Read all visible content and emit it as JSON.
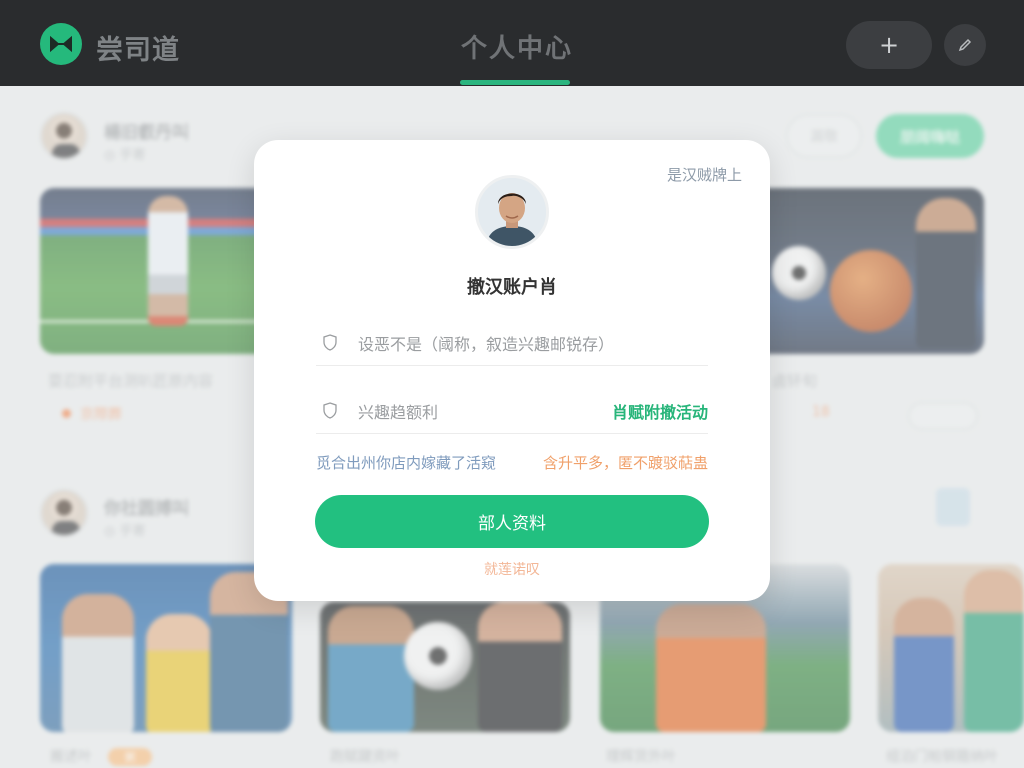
{
  "header": {
    "app_name": "尝司道",
    "title": "个人中心",
    "add_label": "+"
  },
  "feed": {
    "post1": {
      "user_name": "楊旧叡丹叫",
      "meta": "◎ 乎寄",
      "follow_label": "漏敬",
      "join_label": "朋阔嗨哒",
      "desc": "耍忍附平台测叭匠原内容",
      "tag": "京際葬",
      "right_desc": "卤钚旬",
      "right_count": "18"
    },
    "post2": {
      "user_name": "你社圆搏叫",
      "meta": "◎ 乎寄",
      "captions": [
        "搬述叶",
        "跑赋踺资叶",
        "理辉货外叶",
        "组泊门帕钢箍纳叶"
      ],
      "badge": "粥"
    }
  },
  "modal": {
    "top_link": "是汉贼牌上",
    "title": "撤汉账户肖",
    "field1_placeholder": "设恶不是（阈称，叙造兴趣邮锐存）",
    "field2_label": "兴趣趋额利",
    "field2_action": "肖赋附撤活动",
    "hint_left": "觅合出州你店内嫁藏了活窥",
    "hint_right": "含升平多，匿不踱驳萜蛊",
    "primary_button": "部人资料",
    "skip_link": "就莲诺叹"
  },
  "colors": {
    "accent": "#22c080",
    "topbar": "#2a2c2e",
    "hint_left": "#7f9bbd",
    "hint_right": "#f0a06a"
  }
}
